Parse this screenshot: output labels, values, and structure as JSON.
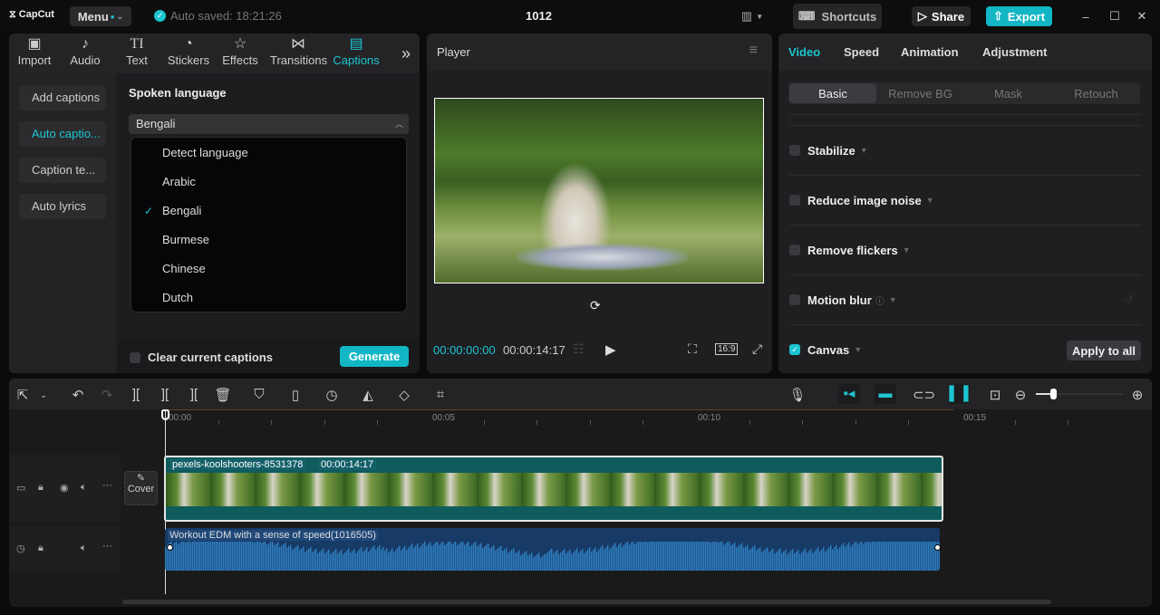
{
  "app": {
    "logo": "CapCut",
    "menu": "Menu",
    "autosave": "Auto saved: 18:21:26",
    "title": "1012",
    "shortcuts": "Shortcuts",
    "share": "Share",
    "export": "Export"
  },
  "colors": {
    "accent": "#1cc5d0",
    "export_bg": "#12b6c4"
  },
  "left_tabs": [
    {
      "label": "Import",
      "icon": "import-icon"
    },
    {
      "label": "Audio",
      "icon": "audio-icon"
    },
    {
      "label": "Text",
      "icon": "text-icon"
    },
    {
      "label": "Stickers",
      "icon": "stickers-icon"
    },
    {
      "label": "Effects",
      "icon": "effects-icon"
    },
    {
      "label": "Transitions",
      "icon": "transitions-icon"
    },
    {
      "label": "Captions",
      "icon": "captions-icon"
    }
  ],
  "caption_menu": [
    "Add captions",
    "Auto captio...",
    "Caption te...",
    "Auto lyrics"
  ],
  "spoken": {
    "heading": "Spoken language",
    "selected": "Bengali",
    "options": [
      "Detect language",
      "Arabic",
      "Bengali",
      "Burmese",
      "Chinese",
      "Dutch"
    ],
    "clear": "Clear current captions",
    "generate": "Generate"
  },
  "player": {
    "title": "Player",
    "current": "00:00:00:00",
    "total": "00:00:14:17",
    "ratio": "16:9"
  },
  "right": {
    "tabs": [
      "Video",
      "Speed",
      "Animation",
      "Adjustment"
    ],
    "subtabs": [
      "Basic",
      "Remove BG",
      "Mask",
      "Retouch"
    ],
    "options": [
      "Stabilize",
      "Reduce image noise",
      "Remove flickers",
      "Motion blur",
      "Canvas"
    ],
    "apply_all": "Apply to all"
  },
  "timeline": {
    "ruler": [
      "00:00",
      "00:05",
      "00:10",
      "00:15"
    ],
    "cover": "Cover",
    "video_clip": {
      "name": "pexels-koolshooters-8531378",
      "duration": "00:00:14:17"
    },
    "audio_clip": {
      "name": "Workout EDM with a sense of speed(1016505)"
    },
    "zoom_level": 0.2
  }
}
